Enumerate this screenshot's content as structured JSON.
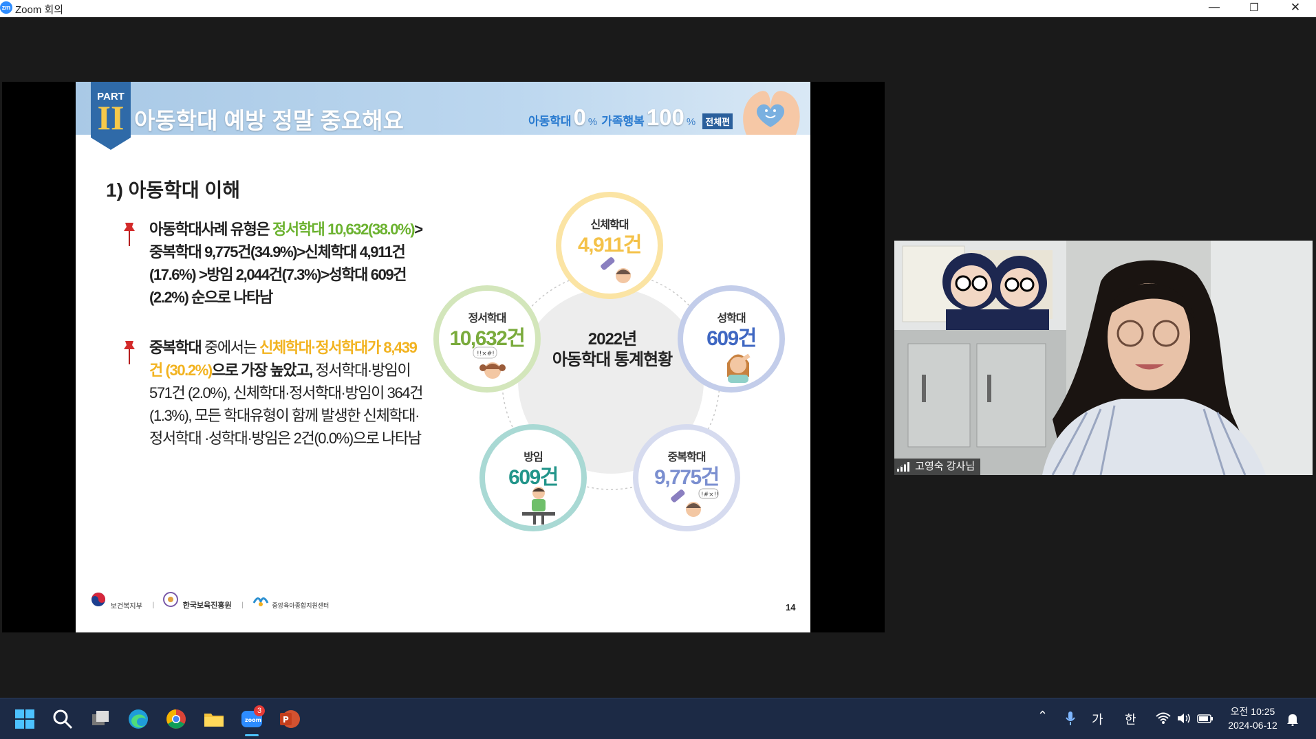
{
  "window": {
    "app_icon": "zm",
    "title": "Zoom 회의",
    "min": "—",
    "restore": "❐",
    "close": "✕"
  },
  "slide": {
    "part_label": "PART",
    "part_numeral": "II",
    "title": "아동학대 예방 정말 중요해요",
    "slogan": {
      "t1": "아동학대",
      "v1": "0",
      "p1": "%",
      "t2": "가족행복",
      "v2": "100",
      "p2": "%",
      "badge": "전체편"
    },
    "section_title": "1) 아동학대 이해",
    "bullet1": {
      "a": "아동학대사례 유형은 ",
      "b": "정서학대 10,632(38.0%)",
      "c": ">중복학대 9,775건(34.9%)>신체학대 4,911건 (17.6%) >방임 2,044건(7.3%)>성학대 609건 (2.2%) 순으로 나타남"
    },
    "bullet2": {
      "a": "중복학대",
      "b": " 중에서는 ",
      "c": "신체학대·정서학대가 8,439건 (30.2%)",
      "d": "으로 가장 높았고,",
      "e": " 정서학대·방임이 571건 (2.0%), 신체학대·정서학대·방임이 364건(1.3%), 모든 학대유형이 함께 발생한 신체학대·정서학대 ·성학대·방임은 2건(0.0%)으로 나타남"
    },
    "diagram": {
      "center_line1": "2022년",
      "center_line2": "아동학대 통계현황",
      "items": [
        {
          "label": "신체학대",
          "value": "4,911건",
          "color": "#f4c24a",
          "ring": "#fbe4a4"
        },
        {
          "label": "성학대",
          "value": "609건",
          "color": "#3f67c2",
          "ring": "#c3cdea"
        },
        {
          "label": "중복학대",
          "value": "9,775건",
          "color": "#7b8fd0",
          "ring": "#d6dbef"
        },
        {
          "label": "방임",
          "value": "609건",
          "color": "#23958a",
          "ring": "#a9d9d4"
        },
        {
          "label": "정서학대",
          "value": "10,632건",
          "color": "#7aab3c",
          "ring": "#d3e6bb"
        }
      ]
    },
    "footer": {
      "org1": "보건복지부",
      "org2": "한국보육진흥원",
      "org3": "중앙육아종합지원센터"
    },
    "page_number": "14"
  },
  "participant": {
    "name": "고영숙 강사님"
  },
  "taskbar": {
    "zoom_badge": "3",
    "ime1": "가",
    "ime2": "한",
    "time_line1": "오전 10:25",
    "time_line2": "2024-06-12"
  }
}
